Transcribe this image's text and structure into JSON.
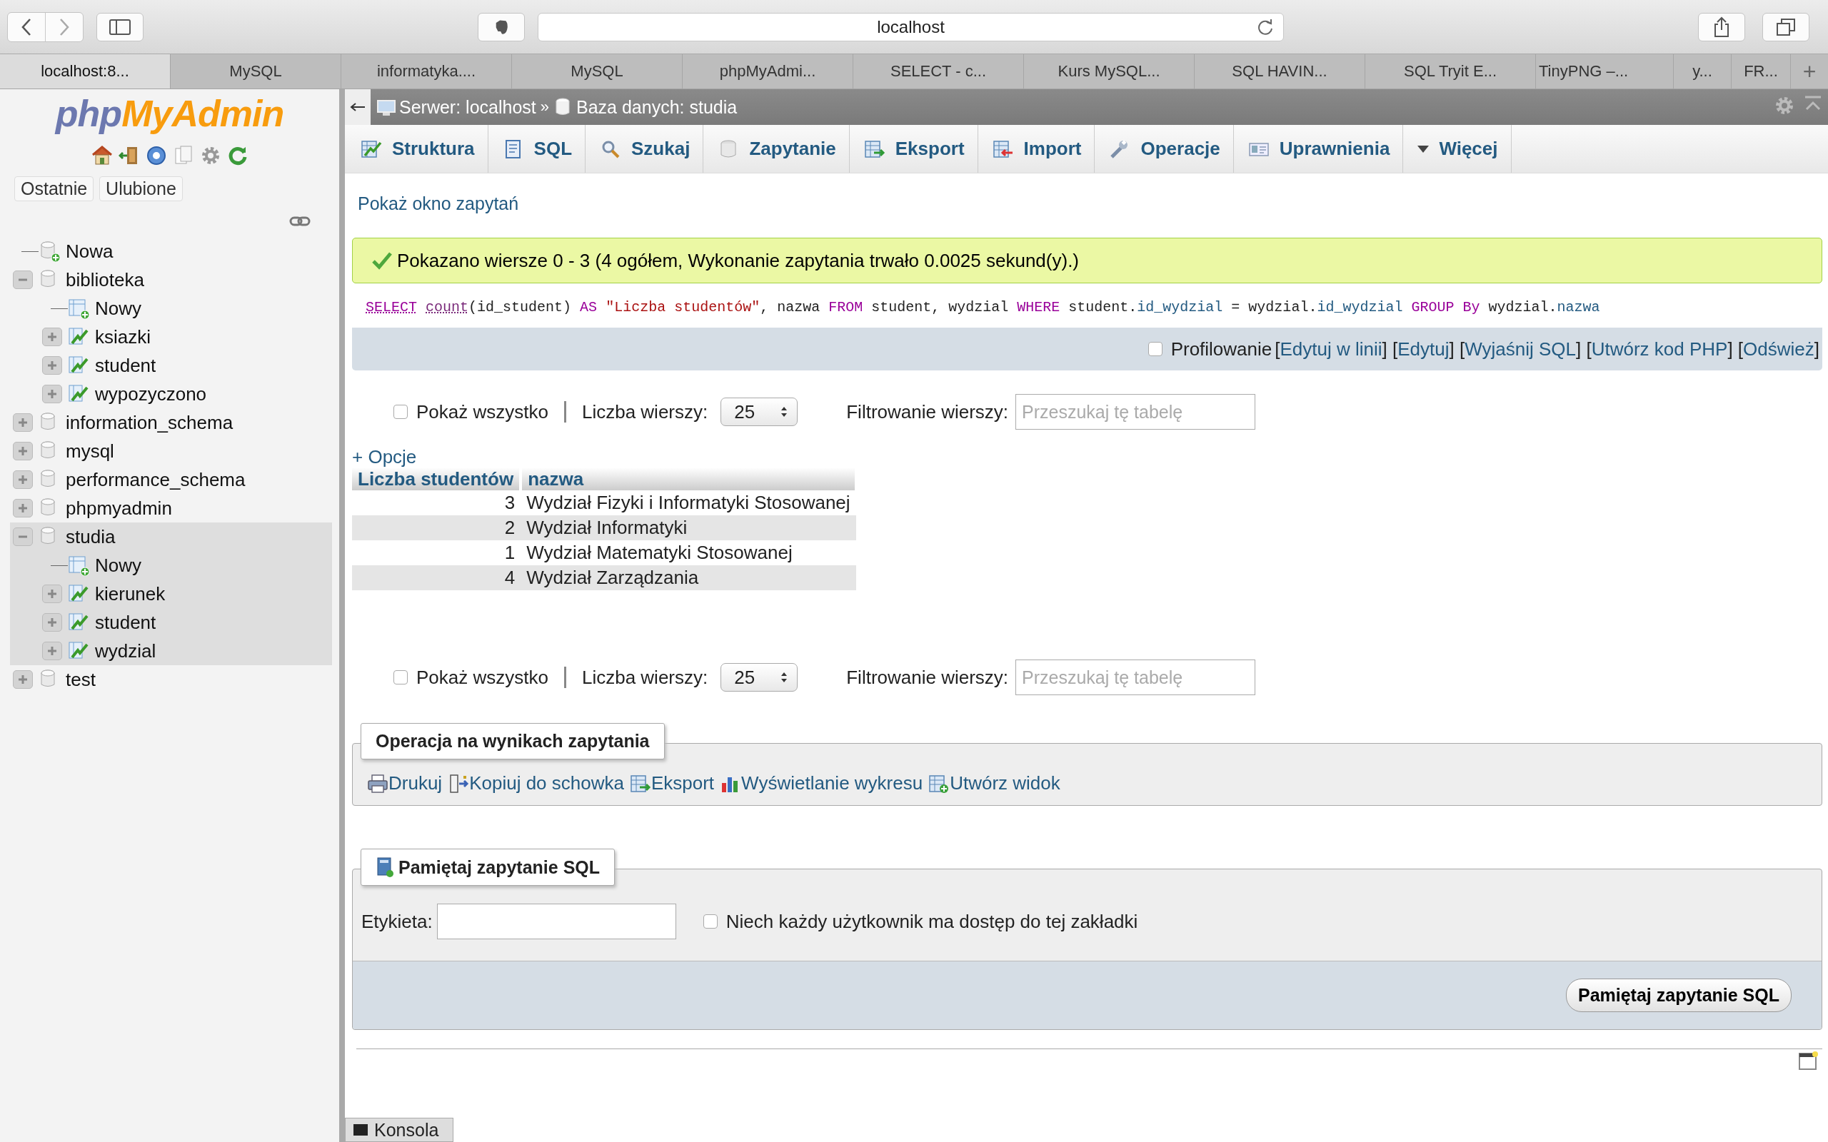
{
  "browser": {
    "address": "localhost",
    "tabs": [
      {
        "label": "localhost:8...",
        "selected": true
      },
      {
        "label": "MySQL",
        "selected": false
      },
      {
        "label": "informatyka....",
        "selected": false
      },
      {
        "label": "MySQL",
        "selected": false
      },
      {
        "label": "phpMyAdmi...",
        "selected": false
      },
      {
        "label": "SELECT - c...",
        "selected": false
      },
      {
        "label": "Kurs MySQL...",
        "selected": false
      },
      {
        "label": "SQL HAVIN...",
        "selected": false
      },
      {
        "label": "SQL Tryit E...",
        "selected": false
      },
      {
        "label": "TinyPNG –...",
        "selected": false
      },
      {
        "label": "y...",
        "selected": false
      },
      {
        "label": "FR...",
        "selected": false
      }
    ],
    "new_tab": "+"
  },
  "sidebar": {
    "logo": {
      "first": "php",
      "second": "MyAdmin"
    },
    "buttons": [
      "Ostatnie",
      "Ulubione"
    ],
    "tree": [
      {
        "label": "Nowa",
        "kind": "new-db",
        "selected": false
      },
      {
        "label": "biblioteka",
        "kind": "db",
        "expanded": true,
        "selected": false,
        "children": [
          {
            "label": "Nowy",
            "kind": "new-table"
          },
          {
            "label": "ksiazki",
            "kind": "table",
            "expanded": false
          },
          {
            "label": "student",
            "kind": "table",
            "expanded": false
          },
          {
            "label": "wypozyczono",
            "kind": "table",
            "expanded": false
          }
        ]
      },
      {
        "label": "information_schema",
        "kind": "db",
        "expanded": false,
        "selected": false
      },
      {
        "label": "mysql",
        "kind": "db",
        "expanded": false,
        "selected": false
      },
      {
        "label": "performance_schema",
        "kind": "db",
        "expanded": false,
        "selected": false
      },
      {
        "label": "phpmyadmin",
        "kind": "db",
        "expanded": false,
        "selected": false
      },
      {
        "label": "studia",
        "kind": "db",
        "expanded": true,
        "selected": true,
        "children": [
          {
            "label": "Nowy",
            "kind": "new-table"
          },
          {
            "label": "kierunek",
            "kind": "table",
            "expanded": false
          },
          {
            "label": "student",
            "kind": "table",
            "expanded": false
          },
          {
            "label": "wydzial",
            "kind": "table",
            "expanded": false
          }
        ]
      },
      {
        "label": "test",
        "kind": "db",
        "expanded": false,
        "selected": false
      }
    ]
  },
  "breadcrumb": {
    "items": [
      {
        "label": "Serwer: localhost",
        "kind": "server"
      },
      {
        "label": "Baza danych: studia",
        "kind": "database"
      }
    ],
    "separator": "»"
  },
  "menu_tabs": [
    {
      "label": "Struktura",
      "kind": "structure"
    },
    {
      "label": "SQL",
      "kind": "sql"
    },
    {
      "label": "Szukaj",
      "kind": "search"
    },
    {
      "label": "Zapytanie",
      "kind": "query"
    },
    {
      "label": "Eksport",
      "kind": "export"
    },
    {
      "label": "Import",
      "kind": "import"
    },
    {
      "label": "Operacje",
      "kind": "operations"
    },
    {
      "label": "Uprawnienia",
      "kind": "privileges"
    },
    {
      "label": "Więcej",
      "kind": "more"
    }
  ],
  "query_window_link": "Pokaż okno zapytań",
  "success_message": "Pokazano wiersze 0 - 3 (4 ogółem, Wykonanie zapytania trwało 0.0025 sekund(y).)",
  "sql_tokens": [
    {
      "text": "SELECT ",
      "kind": "keyword-doc"
    },
    {
      "text": "count",
      "kind": "function-doc"
    },
    {
      "text": "(id_student) ",
      "kind": "plain"
    },
    {
      "text": "AS ",
      "kind": "keyword"
    },
    {
      "text": "\"Liczba studentów\"",
      "kind": "string"
    },
    {
      "text": ", nazwa ",
      "kind": "plain"
    },
    {
      "text": "FROM",
      "kind": "keyword"
    },
    {
      "text": " student, wydzial ",
      "kind": "plain"
    },
    {
      "text": "WHERE",
      "kind": "keyword"
    },
    {
      "text": " student.",
      "kind": "plain"
    },
    {
      "text": "id_wydzial",
      "kind": "column"
    },
    {
      "text": " = wydzial.",
      "kind": "plain"
    },
    {
      "text": "id_wydzial ",
      "kind": "column"
    },
    {
      "text": "GROUP By",
      "kind": "keyword"
    },
    {
      "text": " wydzial.",
      "kind": "plain"
    },
    {
      "text": "nazwa",
      "kind": "column"
    }
  ],
  "profiling": {
    "label": "Profilowanie",
    "checked": false,
    "parts": [
      {
        "text": "[",
        "kind": "plain"
      },
      {
        "text": "Edytuj w linii",
        "kind": "link"
      },
      {
        "text": "] [",
        "kind": "plain"
      },
      {
        "text": "Edytuj",
        "kind": "link"
      },
      {
        "text": "] [",
        "kind": "plain"
      },
      {
        "text": "Wyjaśnij SQL",
        "kind": "link"
      },
      {
        "text": "] [",
        "kind": "plain"
      },
      {
        "text": "Utwórz kod PHP",
        "kind": "link"
      },
      {
        "text": "] [",
        "kind": "plain"
      },
      {
        "text": "Odśwież",
        "kind": "link"
      },
      {
        "text": "]",
        "kind": "plain"
      }
    ]
  },
  "navigation": [
    {
      "show_all": "Pokaż wszystko",
      "show_all_checked": false,
      "rows_label": "Liczba wierszy:",
      "rows_value": "25",
      "filter_label": "Filtrowanie wierszy:",
      "filter_placeholder": "Przeszukaj tę tabelę"
    },
    {
      "show_all": "Pokaż wszystko",
      "show_all_checked": false,
      "rows_label": "Liczba wierszy:",
      "rows_value": "25",
      "filter_label": "Filtrowanie wierszy:",
      "filter_placeholder": "Przeszukaj tę tabelę"
    }
  ],
  "options_link": "+ Opcje",
  "results": {
    "columns": [
      "Liczba studentów",
      "nazwa"
    ],
    "rows": [
      [
        "3",
        "Wydział Fizyki i Informatyki Stosowanej"
      ],
      [
        "2",
        "Wydział Informatyki"
      ],
      [
        "1",
        "Wydział Matematyki Stosowanej"
      ],
      [
        "4",
        "Wydział Zarządzania"
      ]
    ]
  },
  "query_operations": {
    "legend": "Operacja na wynikach zapytania",
    "links": [
      {
        "label": "Drukuj",
        "kind": "print"
      },
      {
        "label": "Kopiuj do schowka",
        "kind": "copy"
      },
      {
        "label": "Eksport",
        "kind": "export"
      },
      {
        "label": "Wyświetlanie wykresu",
        "kind": "chart"
      },
      {
        "label": "Utwórz widok",
        "kind": "view"
      }
    ]
  },
  "bookmark": {
    "legend": "Pamiętaj zapytanie SQL",
    "label_field": "Etykieta:",
    "shared_label": "Niech każdy użytkownik ma dostęp do tej zakładki",
    "shared_checked": false,
    "button": "Pamiętaj zapytanie SQL"
  },
  "console": "Konsola"
}
